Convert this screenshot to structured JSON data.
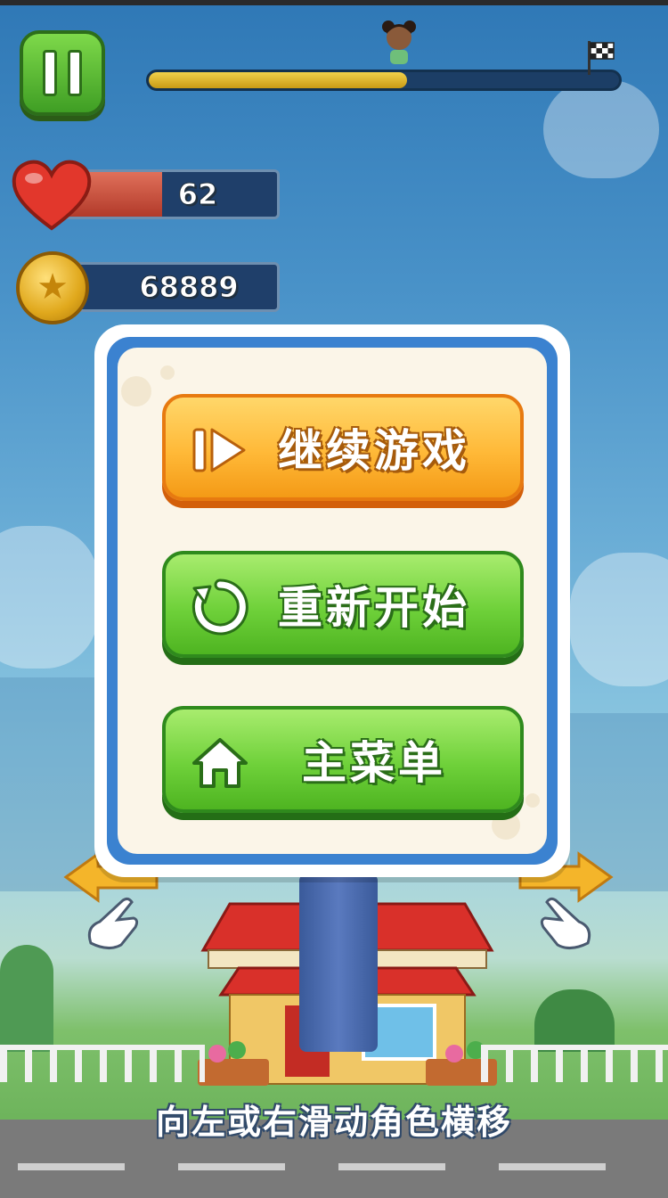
{
  "hud": {
    "pause_icon": "pause-icon",
    "level_progress": 0.55,
    "health": {
      "value": "62",
      "fraction": 0.48
    },
    "coins": {
      "value": "68889"
    }
  },
  "pause_menu": {
    "resume_label": "继续游戏",
    "restart_label": "重新开始",
    "main_menu_label": "主菜单"
  },
  "hint_text": "向左或右滑动角色横移",
  "colors": {
    "resume_button": "#ffb938",
    "green_button": "#6fd13a",
    "dialog_border": "#3b82d0",
    "dialog_bg": "#fbf5e8"
  }
}
